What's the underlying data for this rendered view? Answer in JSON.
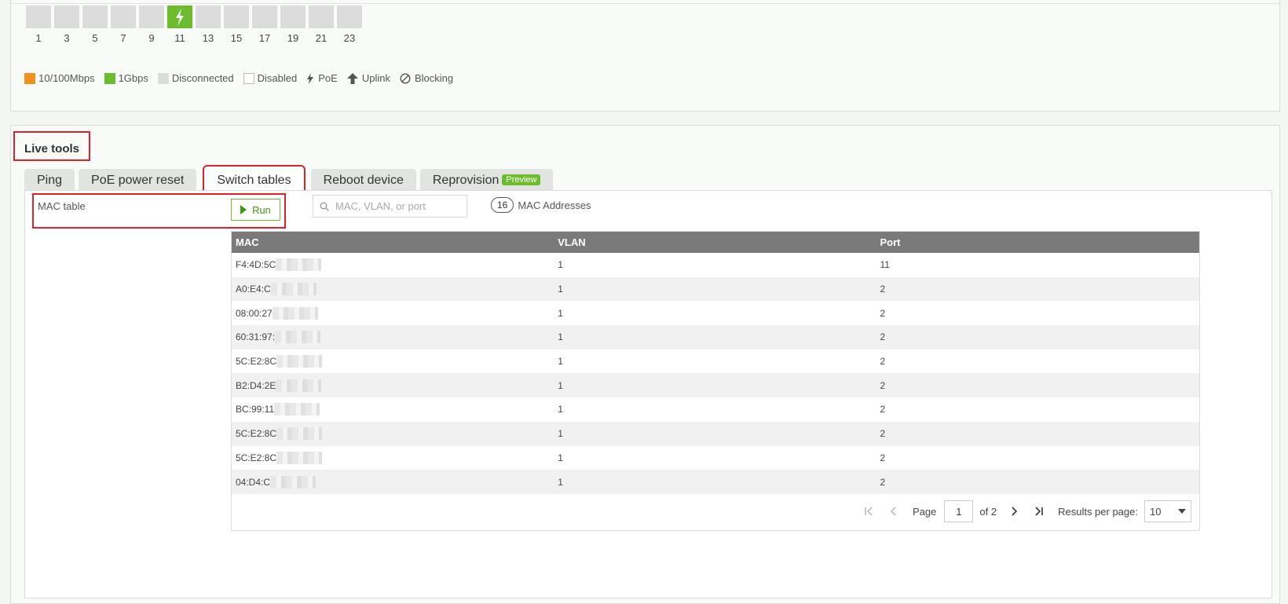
{
  "ports": {
    "numbers": [
      "1",
      "3",
      "5",
      "7",
      "9",
      "11",
      "13",
      "15",
      "17",
      "19",
      "21",
      "23"
    ],
    "active_index": 5
  },
  "legend": {
    "items": [
      {
        "label": "10/100Mbps",
        "color": "#f3901d"
      },
      {
        "label": "1Gbps",
        "color": "#6cbd2d"
      },
      {
        "label": "Disconnected",
        "color": "#dcdcdc"
      },
      {
        "label": "Disabled",
        "color": "#ffffff"
      }
    ],
    "poe_label": "PoE",
    "uplink_label": "Uplink",
    "blocking_label": "Blocking"
  },
  "live_tools": {
    "title": "Live tools",
    "tabs": [
      "Ping",
      "PoE power reset",
      "Switch tables",
      "Reboot device",
      "Reprovision"
    ],
    "preview_badge": "Preview",
    "active_tab": "Switch tables",
    "mac_table_label": "MAC table",
    "run_label": "Run",
    "search_placeholder": "MAC, VLAN, or port",
    "count": "16",
    "count_label": "MAC Addresses"
  },
  "table": {
    "headers": [
      "MAC",
      "VLAN",
      "Port"
    ],
    "rows": [
      {
        "mac": "F4:4D:5C",
        "vlan": "1",
        "port": "11"
      },
      {
        "mac": "A0:E4:C",
        "vlan": "1",
        "port": "2"
      },
      {
        "mac": "08:00:27",
        "vlan": "1",
        "port": "2"
      },
      {
        "mac": "60:31:97:",
        "vlan": "1",
        "port": "2"
      },
      {
        "mac": "5C:E2:8C",
        "vlan": "1",
        "port": "2"
      },
      {
        "mac": "B2:D4:2E",
        "vlan": "1",
        "port": "2"
      },
      {
        "mac": "BC:99:11",
        "vlan": "1",
        "port": "2"
      },
      {
        "mac": "5C:E2:8C",
        "vlan": "1",
        "port": "2"
      },
      {
        "mac": "5C:E2:8C",
        "vlan": "1",
        "port": "2"
      },
      {
        "mac": "04:D4:C",
        "vlan": "1",
        "port": "2"
      }
    ]
  },
  "pagination": {
    "page_label": "Page",
    "current_page": "1",
    "of_label": "of 2",
    "results_label": "Results per page:",
    "per_page": "10"
  }
}
